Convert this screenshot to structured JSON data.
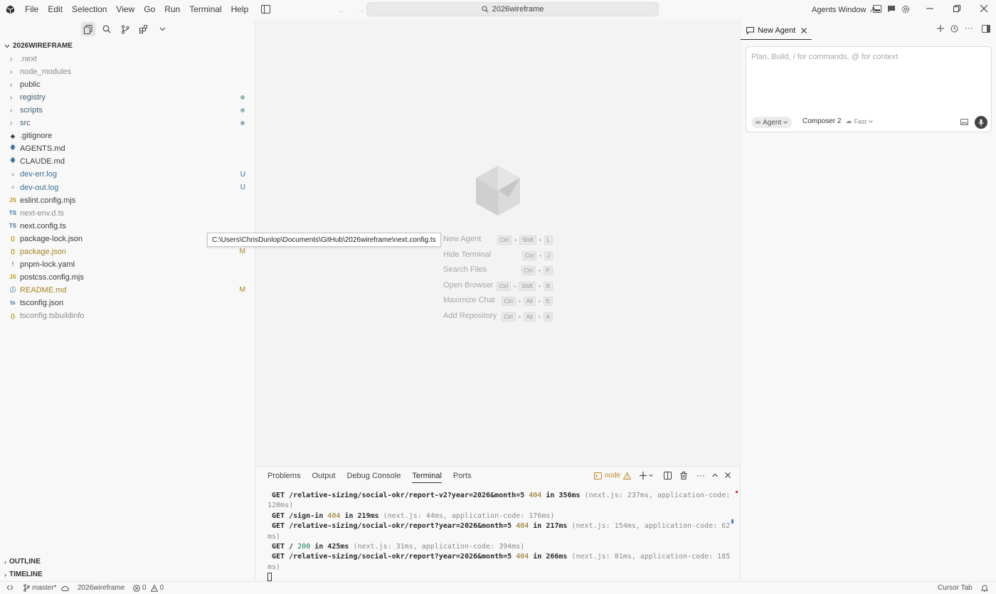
{
  "menu": [
    "File",
    "Edit",
    "Selection",
    "View",
    "Go",
    "Run",
    "Terminal",
    "Help"
  ],
  "titlebar": {
    "search_text": "2026wireframe",
    "agents_window": "Agents Window",
    "back_arrow": "←",
    "forward_arrow": "→"
  },
  "explorer": {
    "folder_title": "2026WIREFRAME",
    "items": [
      {
        "name": ".next",
        "type": "folder",
        "status": "ignored",
        "badge": "",
        "dot": false
      },
      {
        "name": "node_modules",
        "type": "folder",
        "status": "ignored",
        "badge": "",
        "dot": false
      },
      {
        "name": "public",
        "type": "folder",
        "status": "normal",
        "badge": "",
        "dot": false
      },
      {
        "name": "registry",
        "type": "folder",
        "status": "folder",
        "badge": "",
        "dot": true
      },
      {
        "name": "scripts",
        "type": "folder",
        "status": "folder",
        "badge": "",
        "dot": true
      },
      {
        "name": "src",
        "type": "folder",
        "status": "folder",
        "badge": "",
        "dot": true
      },
      {
        "name": ".gitignore",
        "type": "git",
        "status": "normal",
        "badge": "",
        "dot": false
      },
      {
        "name": "AGENTS.md",
        "type": "md",
        "status": "normal",
        "badge": "",
        "dot": false
      },
      {
        "name": "CLAUDE.md",
        "type": "md",
        "status": "normal",
        "badge": "",
        "dot": false
      },
      {
        "name": "dev-err.log",
        "type": "log",
        "status": "untracked",
        "badge": "U",
        "dot": false
      },
      {
        "name": "dev-out.log",
        "type": "log",
        "status": "untracked",
        "badge": "U",
        "dot": false
      },
      {
        "name": "eslint.config.mjs",
        "type": "js",
        "status": "normal",
        "badge": "",
        "dot": false
      },
      {
        "name": "next-env.d.ts",
        "type": "ts",
        "status": "ignored",
        "badge": "",
        "dot": false
      },
      {
        "name": "next.config.ts",
        "type": "ts",
        "status": "normal",
        "badge": "",
        "dot": false
      },
      {
        "name": "package-lock.json",
        "type": "json",
        "status": "normal",
        "badge": "",
        "dot": false
      },
      {
        "name": "package.json",
        "type": "json",
        "status": "modified",
        "badge": "M",
        "dot": false
      },
      {
        "name": "pnpm-lock.yaml",
        "type": "yaml",
        "status": "normal",
        "badge": "",
        "dot": false
      },
      {
        "name": "postcss.config.mjs",
        "type": "js",
        "status": "normal",
        "badge": "",
        "dot": false
      },
      {
        "name": "README.md",
        "type": "info",
        "status": "modified",
        "badge": "M",
        "dot": false
      },
      {
        "name": "tsconfig.json",
        "type": "tsjson",
        "status": "normal",
        "badge": "",
        "dot": false
      },
      {
        "name": "tsconfig.tsbuildinfo",
        "type": "json",
        "status": "ignored",
        "badge": "",
        "dot": false
      }
    ],
    "outline": "OUTLINE",
    "timeline": "TIMELINE"
  },
  "icon_glyphs": {
    "js": "JS",
    "ts": "TS",
    "json": "{}",
    "yaml": "!",
    "info": "ⓘ",
    "md": "🡇",
    "git": "◆",
    "log": "≡",
    "tsjson": "ts"
  },
  "tooltip": "C:\\Users\\ChrisDunlop\\Documents\\GitHub\\2026wireframe\\next.config.ts",
  "shortcuts": [
    {
      "label": "New Agent",
      "keys": [
        "Ctrl",
        "Shift",
        "L"
      ]
    },
    {
      "label": "Hide Terminal",
      "keys": [
        "Ctrl",
        "J"
      ]
    },
    {
      "label": "Search Files",
      "keys": [
        "Ctrl",
        "P"
      ]
    },
    {
      "label": "Open Browser",
      "keys": [
        "Ctrl",
        "Shift",
        "B"
      ]
    },
    {
      "label": "Maximize Chat",
      "keys": [
        "Ctrl",
        "Alt",
        "E"
      ]
    },
    {
      "label": "Add Repository",
      "keys": [
        "Ctrl",
        "Alt",
        "A"
      ]
    }
  ],
  "panel": {
    "tabs": [
      "Problems",
      "Output",
      "Debug Console",
      "Terminal",
      "Ports"
    ],
    "active_tab": "Terminal",
    "terminal_name": "node"
  },
  "terminal_lines": [
    [
      {
        "t": " GET /relative-sizing/social-okr/report-v2?year=2026&month=5 ",
        "c": "b"
      },
      {
        "t": "404",
        "c": "num"
      },
      {
        "t": " in 356ms ",
        "c": "b"
      },
      {
        "t": "(next.js: 237ms, application-code:",
        "c": "dim"
      }
    ],
    [
      {
        "t": "120ms)",
        "c": "dim"
      }
    ],
    [
      {
        "t": " GET /sign-in ",
        "c": "b"
      },
      {
        "t": "404",
        "c": "num"
      },
      {
        "t": " in 219ms ",
        "c": "b"
      },
      {
        "t": "(next.js: 44ms, application-code: 176ms)",
        "c": "dim"
      }
    ],
    [
      {
        "t": " GET /relative-sizing/social-okr/report?year=2026&month=5 ",
        "c": "b"
      },
      {
        "t": "404",
        "c": "num"
      },
      {
        "t": " in 217ms ",
        "c": "b"
      },
      {
        "t": "(next.js: 154ms, application-code: 62",
        "c": "dim"
      }
    ],
    [
      {
        "t": "ms)",
        "c": "dim"
      }
    ],
    [
      {
        "t": " GET / ",
        "c": "b"
      },
      {
        "t": "200",
        "c": "ok"
      },
      {
        "t": " in 425ms ",
        "c": "b"
      },
      {
        "t": "(next.js: 31ms, application-code: 394ms)",
        "c": "dim"
      }
    ],
    [
      {
        "t": " GET /relative-sizing/social-okr/report?year=2026&month=5 ",
        "c": "b"
      },
      {
        "t": "404",
        "c": "num"
      },
      {
        "t": " in 266ms ",
        "c": "b"
      },
      {
        "t": "(next.js: 81ms, application-code: 185",
        "c": "dim"
      }
    ],
    [
      {
        "t": "ms)",
        "c": "dim"
      }
    ]
  ],
  "agent": {
    "tab_label": "New Agent",
    "placeholder": "Plan, Build, / for commands, @ for context",
    "mode": "Agent",
    "model": "Composer 2",
    "speed": "Fast"
  },
  "status": {
    "branch": "master*",
    "workspace": "2026wireframe",
    "errors": "0",
    "warnings": "0",
    "cursor_tab": "Cursor Tab"
  }
}
